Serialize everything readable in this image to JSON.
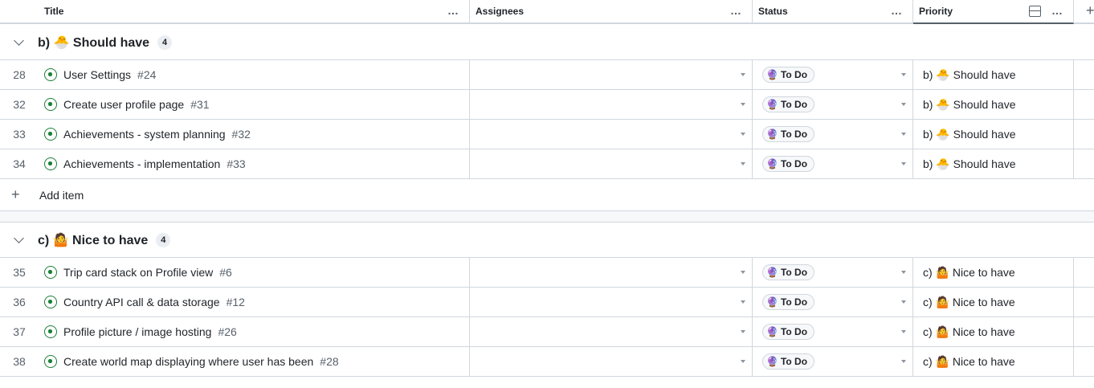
{
  "columns": {
    "title": "Title",
    "assignees": "Assignees",
    "status": "Status",
    "priority": "Priority"
  },
  "icons": {
    "header_menu": "…",
    "add_column": "+",
    "add_item": "+"
  },
  "groups": [
    {
      "label": "b) 🐣 Should have",
      "count": "4",
      "items": [
        {
          "num": "28",
          "title": "User Settings",
          "ref": "#24",
          "status": "To Do",
          "status_emoji": "🔮",
          "priority": "b) 🐣 Should have"
        },
        {
          "num": "32",
          "title": "Create user profile page",
          "ref": "#31",
          "status": "To Do",
          "status_emoji": "🔮",
          "priority": "b) 🐣 Should have"
        },
        {
          "num": "33",
          "title": "Achievements - system planning",
          "ref": "#32",
          "status": "To Do",
          "status_emoji": "🔮",
          "priority": "b) 🐣 Should have"
        },
        {
          "num": "34",
          "title": "Achievements - implementation",
          "ref": "#33",
          "status": "To Do",
          "status_emoji": "🔮",
          "priority": "b) 🐣 Should have"
        }
      ],
      "add_label": "Add item"
    },
    {
      "label": "c) 🤷 Nice to have",
      "count": "4",
      "items": [
        {
          "num": "35",
          "title": "Trip card stack on Profile view",
          "ref": "#6",
          "status": "To Do",
          "status_emoji": "🔮",
          "priority": "c) 🤷 Nice to have"
        },
        {
          "num": "36",
          "title": "Country API call & data storage",
          "ref": "#12",
          "status": "To Do",
          "status_emoji": "🔮",
          "priority": "c) 🤷 Nice to have"
        },
        {
          "num": "37",
          "title": "Profile picture / image hosting",
          "ref": "#26",
          "status": "To Do",
          "status_emoji": "🔮",
          "priority": "c) 🤷 Nice to have"
        },
        {
          "num": "38",
          "title": "Create world map displaying where user has been",
          "ref": "#28",
          "status": "To Do",
          "status_emoji": "🔮",
          "priority": "c) 🤷 Nice to have"
        }
      ]
    }
  ],
  "colors": {
    "open_issue": "#1a7f37",
    "border": "#d0d7de",
    "muted": "#57606a"
  }
}
